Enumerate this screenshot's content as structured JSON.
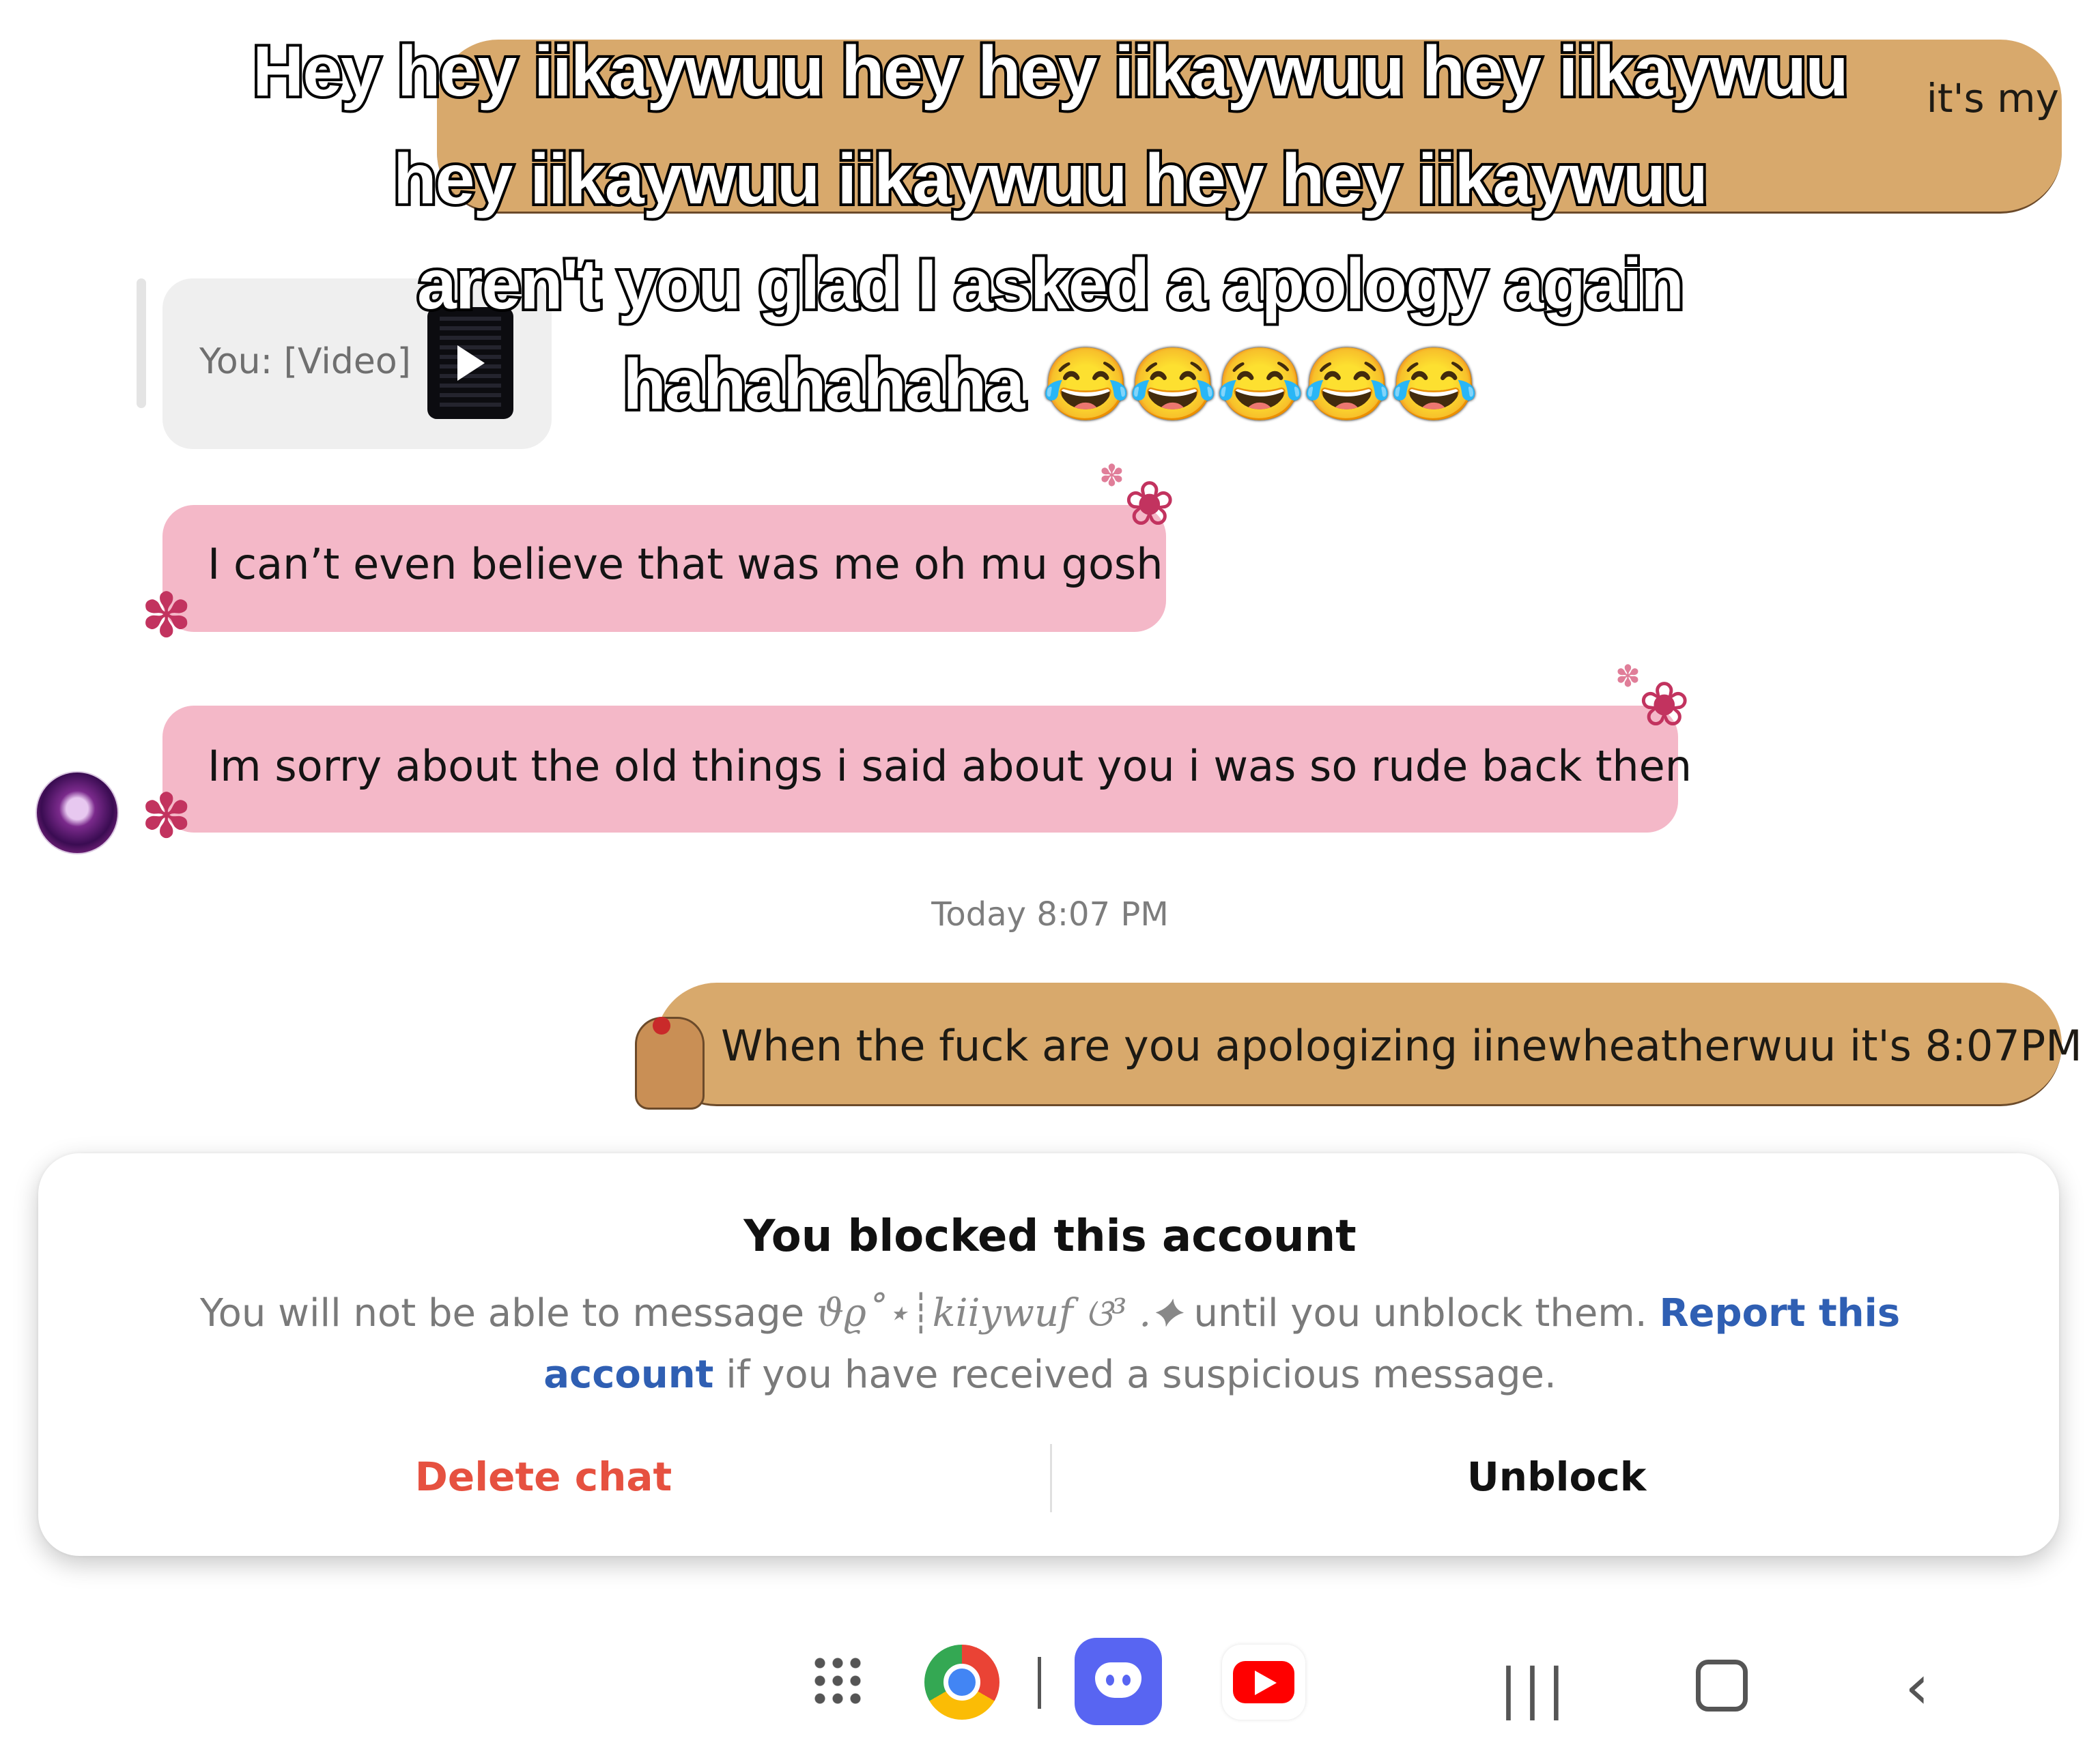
{
  "top_bubble": {
    "text": "it's my"
  },
  "reply_preview": {
    "text": "You: [Video]"
  },
  "messages": [
    {
      "text": "I can’t even believe that was me oh mu gosh"
    },
    {
      "text": "Im sorry about the old things i said about you i was so rude back then"
    }
  ],
  "timestamp": "Today 8:07 PM",
  "sent_message": {
    "text": "When the fuck are you apologizing iinewheatherwuu it's 8:07PM"
  },
  "caption": {
    "line1": "Hey hey iikaywuu hey hey iikaywuu hey iikaywuu",
    "line2": "hey iikaywuu iikaywuu hey hey iikaywuu",
    "line3": "aren't you glad I asked a apology again",
    "line4": "hahahahaha 😂😂😂😂😂"
  },
  "blocked_card": {
    "title": "You blocked this account",
    "body_prefix": "You will not be able to message",
    "username": "ϑϱ˚⋆┊kiiywuf ଓ³ .✦",
    "body_middle": "until you unblock them.",
    "report_link": "Report this account",
    "body_suffix": "if you have received a suspicious message.",
    "delete_label": "Delete chat",
    "unblock_label": "Unblock",
    "colors": {
      "delete": "#e65140",
      "link": "#2f5fb3"
    }
  },
  "taskbar": {
    "icons": [
      "apps-grid-icon",
      "chrome-icon",
      "discord-icon",
      "youtube-icon"
    ],
    "nav": {
      "recents": "|||",
      "back": "‹"
    }
  },
  "colors": {
    "received_bubble": "#f4b8c8",
    "sent_bubble": "#d8a96c"
  }
}
